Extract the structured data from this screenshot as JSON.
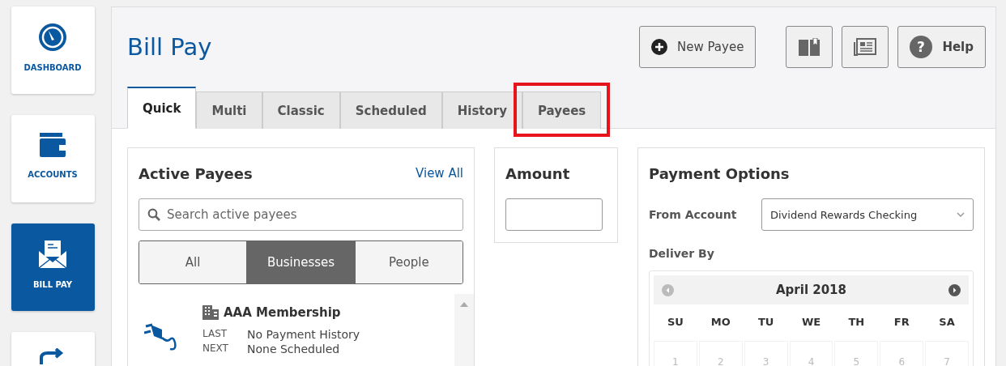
{
  "nav": [
    {
      "label": "DASHBOARD",
      "selected": false
    },
    {
      "label": "ACCOUNTS",
      "selected": false
    },
    {
      "label": "BILL PAY",
      "selected": true
    },
    {
      "selected": false
    }
  ],
  "title": "Bill Pay",
  "actions": {
    "new_payee": "New Payee",
    "help": "Help",
    "help_glyph": "?"
  },
  "tabs": [
    {
      "label": "Quick",
      "selected": true,
      "highlighted": false
    },
    {
      "label": "Multi",
      "selected": false,
      "highlighted": false
    },
    {
      "label": "Classic",
      "selected": false,
      "highlighted": false
    },
    {
      "label": "Scheduled",
      "selected": false,
      "highlighted": false
    },
    {
      "label": "History",
      "selected": false,
      "highlighted": false
    },
    {
      "label": "Payees",
      "selected": false,
      "highlighted": true
    }
  ],
  "payees_panel": {
    "title": "Active Payees",
    "link": "View All",
    "search": {
      "placeholder": "Search active payees"
    },
    "filters": [
      {
        "label": "All",
        "selected": false
      },
      {
        "label": "Businesses",
        "selected": true
      },
      {
        "label": "People",
        "selected": false
      }
    ],
    "payees": [
      {
        "name": "AAA Membership",
        "details": [
          {
            "label": "LAST",
            "value": "No Payment History"
          },
          {
            "label": "NEXT",
            "value": "None Scheduled"
          }
        ]
      }
    ]
  },
  "amount_panel": {
    "title": "Amount"
  },
  "options_panel": {
    "title": "Payment Options",
    "from_label": "From Account",
    "from_value": "Dividend Rewards Checking",
    "deliver_label": "Deliver By",
    "calendar": {
      "month": "April 2018",
      "weekdays": [
        "SU",
        "MO",
        "TU",
        "WE",
        "TH",
        "FR",
        "SA"
      ],
      "days": [
        "1",
        "2",
        "3",
        "4",
        "5",
        "6",
        "7"
      ]
    }
  }
}
